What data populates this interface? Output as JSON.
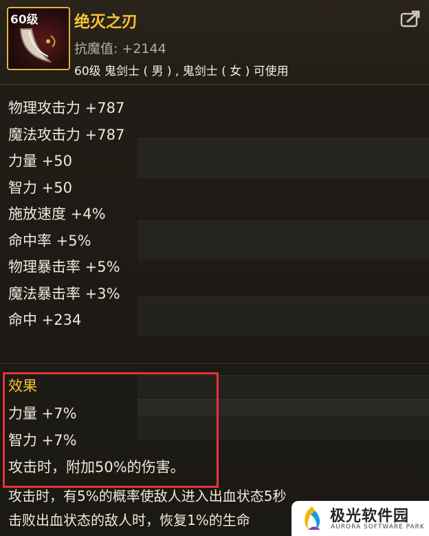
{
  "item": {
    "level_badge": "60级",
    "name": "绝灭之刃",
    "anti_magic_label": "抗魔值:",
    "anti_magic_value": "+2144",
    "usable_by": "60级 鬼剑士 ( 男 ) , 鬼剑士 ( 女 ) 可使用",
    "icon": "curved-blade-icon"
  },
  "header": {
    "share_icon": "share-export-icon"
  },
  "attributes": [
    "物理攻击力 +787",
    "魔法攻击力 +787",
    "力量 +50",
    "智力 +50",
    "施放速度 +4%",
    "命中率 +5%",
    "物理暴击率 +5%",
    "魔法暴击率 +3%",
    "命中 +234"
  ],
  "effect": {
    "title": "效果",
    "lines": [
      "力量 +7%",
      "智力 +7%",
      "攻击时，附加50%的伤害。"
    ],
    "highlight_color": "#e8343a"
  },
  "extra_effects": [
    "攻击时，有5%的概率使敌人进入出血状态5秒",
    "击败出血状态的敌人时，恢复1%的生命"
  ],
  "watermark": {
    "title": "极光软件园",
    "subtitle": "AURORA SOFTWARE PARK"
  },
  "colors": {
    "name": "#f5c232",
    "text": "#efe9da",
    "muted": "#b6b0a3"
  }
}
